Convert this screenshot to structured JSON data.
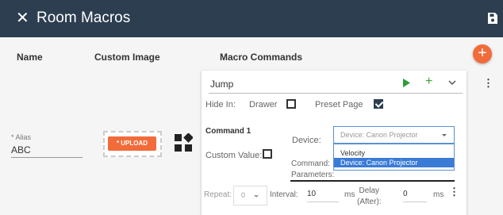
{
  "header": {
    "title": "Room Macros",
    "close_glyph": "✕",
    "save_icon": "save-icon"
  },
  "columns": {
    "name": "Name",
    "custom_image": "Custom Image",
    "macro_commands": "Macro Commands"
  },
  "add_button_glyph": "+",
  "alias": {
    "label": "* Alias",
    "value": "ABC"
  },
  "image": {
    "upload_label": "* UPLOAD",
    "icon": "widgets-icon"
  },
  "macro": {
    "name": "Jump",
    "play_icon": "play-icon",
    "add_glyph": "+",
    "expand_icon": "chevron-down-icon",
    "more_glyph": "⋮",
    "hide_in_label": "Hide In:",
    "drawer_label": "Drawer",
    "drawer_checked": false,
    "preset_page_label": "Preset Page",
    "preset_page_checked": true,
    "command": {
      "title": "Command 1",
      "device_label": "Device:",
      "device_placeholder": "Device: Canon Projector",
      "device_options": [
        "Velocity",
        "Device: Canon Projector"
      ],
      "selected_option": "Device: Canon Projector",
      "custom_value_label": "Custom Value:",
      "custom_value_checked": false,
      "command_params_label_1": "Command:",
      "command_params_label_2": "Parameters:",
      "repeat_label": "Repeat:",
      "repeat_value": "0",
      "interval_label": "Interval:",
      "interval_value": "10",
      "interval_unit": "ms",
      "delay_label_1": "Delay",
      "delay_label_2": "(After):",
      "delay_value": "0",
      "delay_unit": "ms",
      "more_glyph": "⋮"
    }
  },
  "colors": {
    "header_bg": "#2c3e50",
    "accent": "#f26b3a",
    "play_green": "#3aa63a",
    "selection_blue": "#3a7bd5"
  }
}
